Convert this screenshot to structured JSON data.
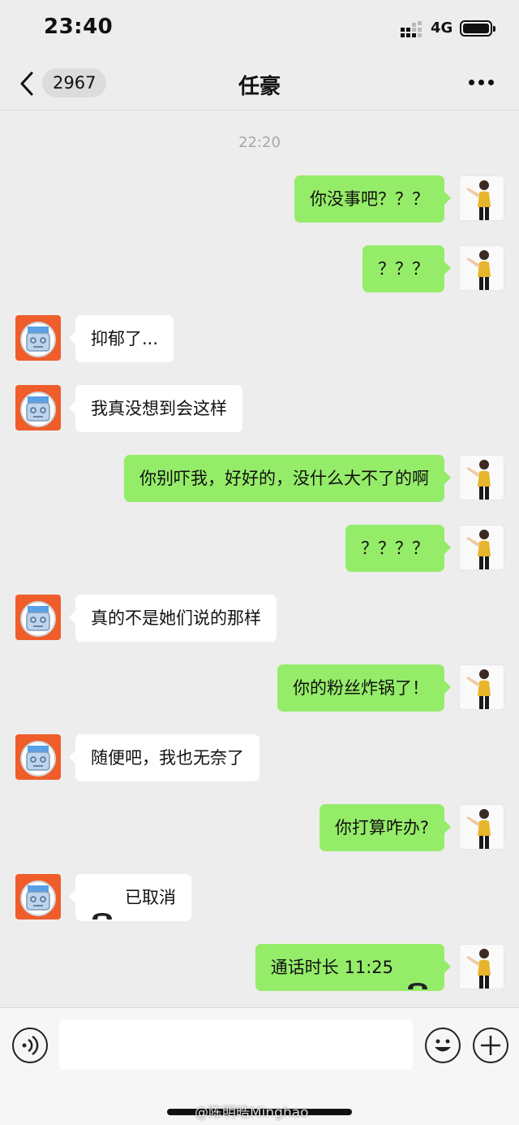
{
  "status_bar": {
    "time": "23:40",
    "network": "4G"
  },
  "nav": {
    "back_count": "2967",
    "title": "任豪"
  },
  "chat": {
    "timestamp": "22:20",
    "messages": [
      {
        "from": "me",
        "text": "你没事吧？？？"
      },
      {
        "from": "me",
        "text": "？？？"
      },
      {
        "from": "other",
        "text": "抑郁了..."
      },
      {
        "from": "other",
        "text": "我真没想到会这样"
      },
      {
        "from": "me",
        "text": "你别吓我，好好的，没什么大不了的啊"
      },
      {
        "from": "me",
        "text": "？？？？"
      },
      {
        "from": "other",
        "text": "真的不是她们说的那样"
      },
      {
        "from": "me",
        "text": "你的粉丝炸锅了！"
      },
      {
        "from": "other",
        "text": "随便吧，我也无奈了"
      },
      {
        "from": "me",
        "text": "你打算咋办?"
      },
      {
        "from": "other",
        "text": "已取消",
        "icon": "phone-hangup-icon"
      },
      {
        "from": "me",
        "text": "通话时长 11:25",
        "icon": "phone-hangup-icon"
      }
    ]
  },
  "input": {
    "placeholder": ""
  },
  "watermark": "@陈明晧Minghao",
  "colors": {
    "my_bubble": "#95ec69",
    "other_bubble": "#ffffff",
    "background": "#ededed",
    "other_avatar": "#ef5d2b"
  }
}
